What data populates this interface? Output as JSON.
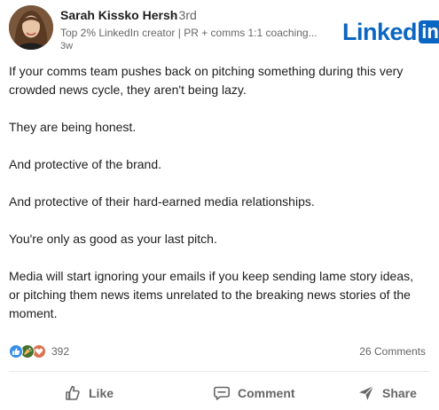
{
  "post": {
    "author": {
      "name": "Sarah Kissko Hersh",
      "degree": "· 3rd",
      "headline": "Top 2% LinkedIn creator | PR + comms 1:1 coaching...",
      "time": "3w"
    },
    "brand": {
      "logo_text": "Linked",
      "logo_box": "in",
      "color": "#0a66c2"
    },
    "paragraphs": [
      {
        "lines": [
          "If your comms team pushes back on pitching something during this very",
          "crowded news cycle, they aren't being lazy."
        ]
      },
      {
        "lines": [
          "They are being honest."
        ]
      },
      {
        "lines": [
          "And protective of the brand."
        ]
      },
      {
        "lines": [
          "And protective of their hard-earned media relationships."
        ]
      },
      {
        "lines": [
          "You're only as good as your last pitch."
        ]
      },
      {
        "lines": [
          "Media will start ignoring your emails if you keep sending lame story ideas,",
          "or pitching them news items unrelated to the breaking news stories of the",
          "moment."
        ]
      }
    ],
    "social": {
      "reactions": [
        "like-icon",
        "celebrate-icon",
        "love-icon"
      ],
      "reaction_count": "392",
      "comments": "26 Comments"
    },
    "actions": {
      "like": "Like",
      "comment": "Comment",
      "share": "Share"
    }
  }
}
